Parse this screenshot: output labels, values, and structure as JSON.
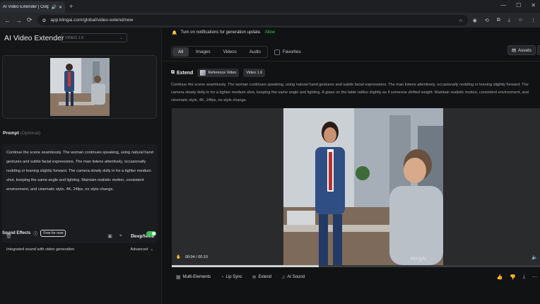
{
  "browser": {
    "tab_title": "AI Video Extender | Outpu",
    "new_tab": "+",
    "url": "app.klingai.com/global/video-extend/new",
    "window_controls": [
      "—",
      "☐",
      "✕"
    ]
  },
  "left_panel": {
    "app_title": "AI Video Extender",
    "model_select": "VIDEO 1.6",
    "prompt_label": "Prompt",
    "prompt_optional": "(Optional)",
    "prompt_text": "Continue the scene seamlessly. The woman continues speaking, using natural hand gestures and subtle facial expressions. The man listens attentively, occasionally nodding or leaning slightly forward. The camera slowly dolly in for a tighter medium shot, keeping the same angle and lighting.  Maintain realistic motion, consistent environment, and cinematic style, 4K, 24fps, no style change.",
    "deepseek_label": "DeepSeek",
    "sound_effects_label": "Sound Effects",
    "sound_effects_badge": "Free for now",
    "sound_effects_enabled": true,
    "integrated_label": "Integrated sound with video generation",
    "advanced_label": "Advanced"
  },
  "right_panel": {
    "notification_text": "Turn on notifications for generation update.",
    "notification_action": "Allow",
    "filters": [
      "All",
      "Images",
      "Videos",
      "Audio"
    ],
    "active_filter": "All",
    "favorites_label": "Favorites",
    "assets_label": "Assets",
    "extend_title": "Extend",
    "reference_pill": "Reference Video",
    "version_pill": "Video 1.6",
    "description": "Continue the scene seamlessly. The woman continues speaking, using natural hand gestures and subtle facial expressions. The man listens attentively, occasionally nodding or leaning slightly forward. The camera slowly dolly in for a tighter medium shot, keeping the same angle and lighting. A glass on the table rattles slightly as if someone shifted weight. Maintain realistic motion, consistent environment, and cinematic style, 4K, 24fps, no style change.",
    "time_display": "00:04 / 00:10",
    "watermark": "KlingAI",
    "progress": 0.4,
    "actions": [
      "Multi-Elements",
      "Lip Sync",
      "Extend",
      "AI Sound"
    ]
  },
  "icons": [
    "speaker-icon",
    "close-icon",
    "site-info-icon",
    "star-icon",
    "extension-icon",
    "download-icon",
    "menu-icon",
    "bell-icon",
    "delete-icon",
    "save-icon",
    "location-icon",
    "info-icon",
    "chevron-down-icon",
    "play-icon",
    "volume-icon",
    "thumbs-up-icon",
    "thumbs-down-icon",
    "more-icon"
  ]
}
